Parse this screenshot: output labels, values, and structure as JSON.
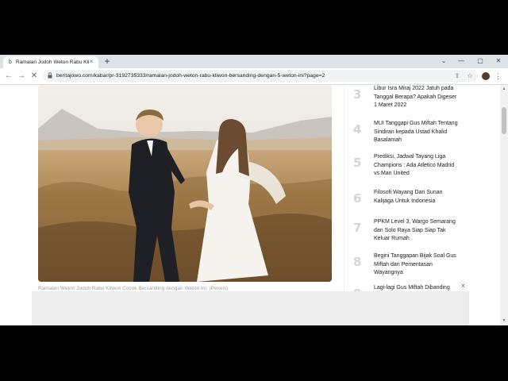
{
  "tab": {
    "favicon": "b",
    "title": "Ramalan Jodoh Weton Rabu Kliwon Bersanding dengan 5 Weton ini",
    "close": "×",
    "new_tab": "+"
  },
  "window_controls": {
    "minimize": "—",
    "maximize": "▢",
    "close": "✕",
    "tabs_menu": "⌄"
  },
  "toolbar": {
    "back": "←",
    "forward": "→",
    "reload": "✕",
    "url": "beritajowo.com/kabar/pr-3192735333/ramalan-jodoh-weton-rabu-kliwon-bersanding-dengan-5-weton-ini?page=2",
    "share_icon": "⇪",
    "star_icon": "☆",
    "menu": "⋮"
  },
  "article": {
    "caption": "Ramalan Weton Jodoh Rabu Kliwon Cocok Bersanding dengan Weton Ini. (Pexels)"
  },
  "sidebar": {
    "items": [
      {
        "num": "3",
        "title": "Libur Isra Miraj 2022 Jatuh pada Tanggal Berapa? Apakah Digeser 1 Maret 2022"
      },
      {
        "num": "4",
        "title": "MUI Tanggapi Gus Miftah Tentang Sindiran kepada Ustad Khalid Basalamah"
      },
      {
        "num": "5",
        "title": "Prediksi, Jadwal Tayang Liga Champions : Ada Atletico Madrid vs Man United"
      },
      {
        "num": "6",
        "title": "Filosofi Wayang Dari Sunan Kalijaga Untuk Indonesia"
      },
      {
        "num": "7",
        "title": "PPKM Level 3, Wargo Semarang dan Solo Raya Siap Siap Tak Keluar Rumah"
      },
      {
        "num": "8",
        "title": "Begini Tanggapan Bijak Soal Gus Miftah dan Pementasan Wayangnya"
      },
      {
        "num": "9",
        "title": "Lagi-lagi Gus Miftah Dibanding"
      }
    ]
  },
  "ad": {
    "close": "x"
  }
}
